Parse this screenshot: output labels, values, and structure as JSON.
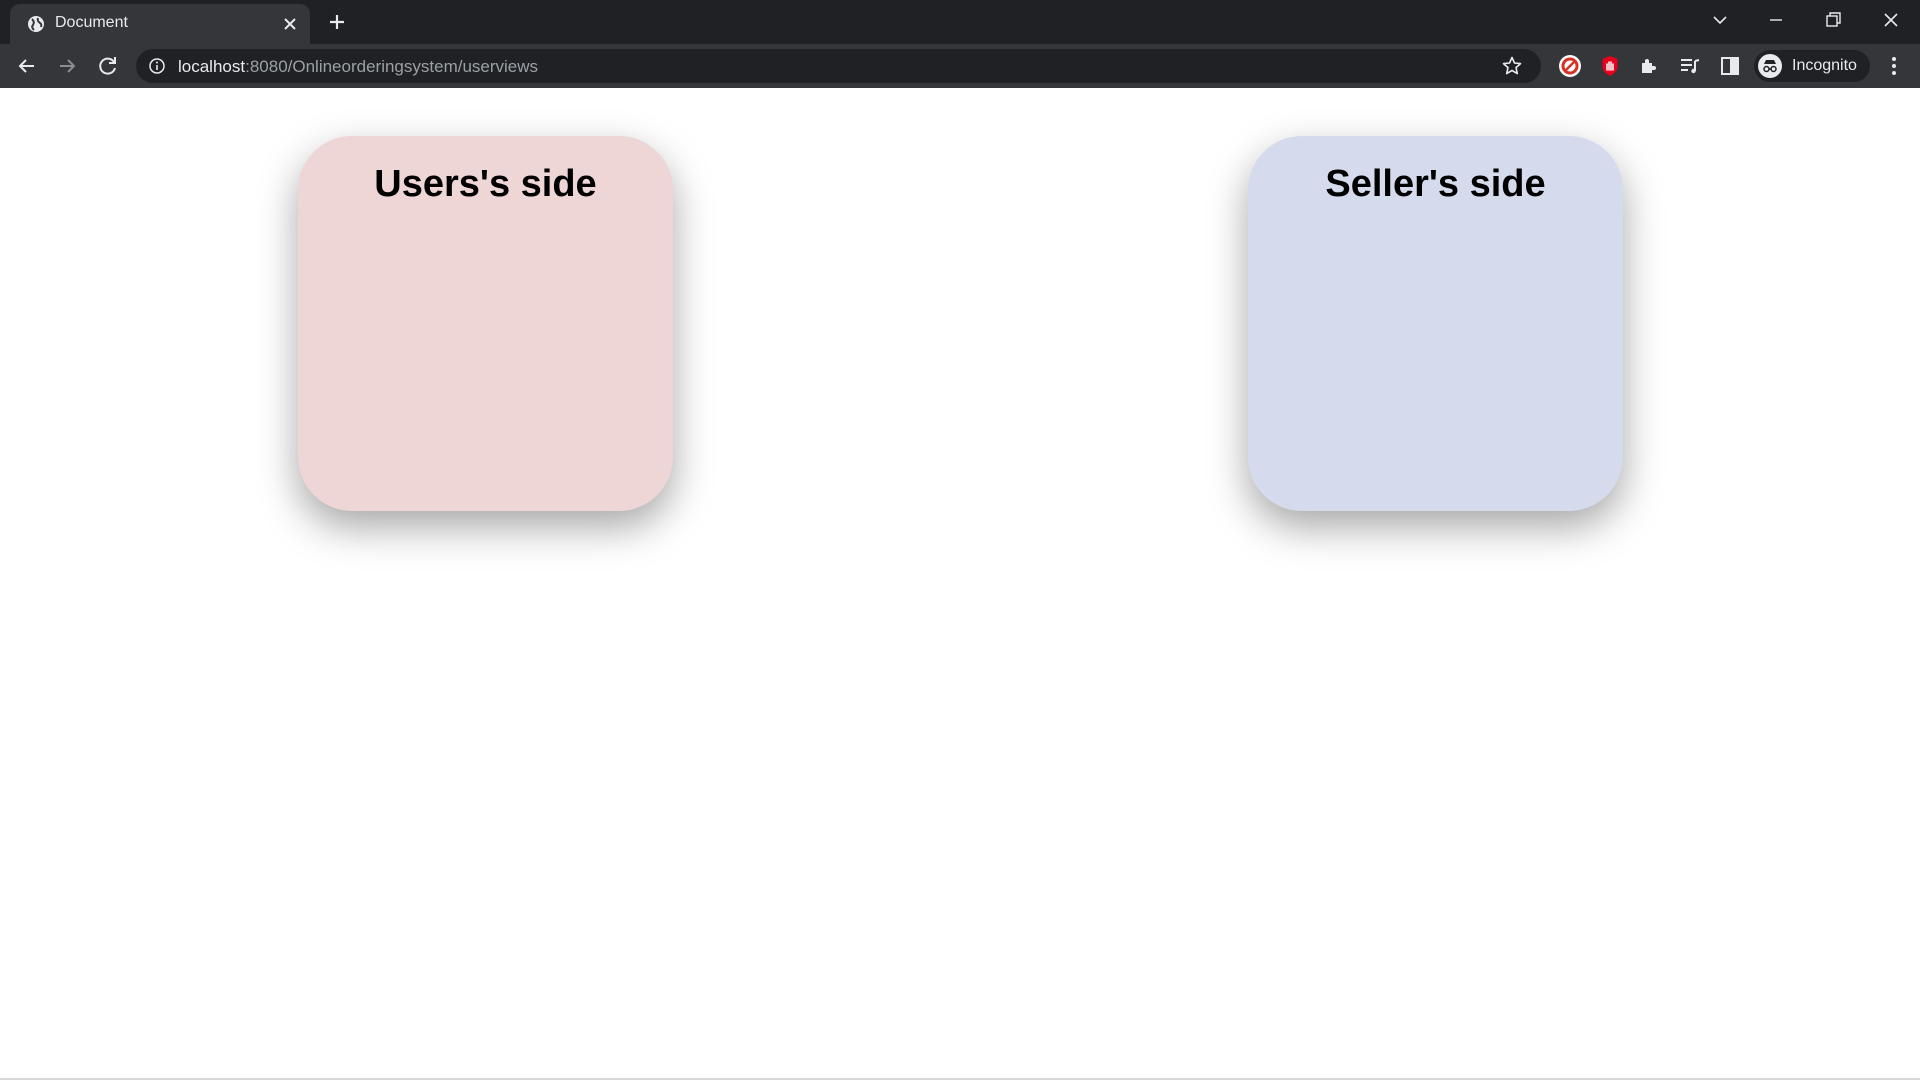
{
  "browser": {
    "tab_title": "Document",
    "url_host": "localhost",
    "url_path": ":8080/Onlineorderingsystem/userviews",
    "profile_label": "Incognito",
    "icons": [
      "globe-icon",
      "close-icon",
      "plus-icon",
      "chevron-down-icon",
      "minimize-icon",
      "restore-icon",
      "window-close-icon",
      "back-icon",
      "forward-icon",
      "reload-icon",
      "info-icon",
      "star-icon",
      "no-sign-extension-icon",
      "hand-extension-icon",
      "puzzle-icon",
      "media-queue-icon",
      "side-panel-icon",
      "incognito-icon",
      "kebab-menu-icon"
    ]
  },
  "page": {
    "users_card": {
      "title": "Users's side",
      "color": "#eed5d6"
    },
    "seller_card": {
      "title": "Seller's side",
      "color": "#d5dbed"
    }
  }
}
